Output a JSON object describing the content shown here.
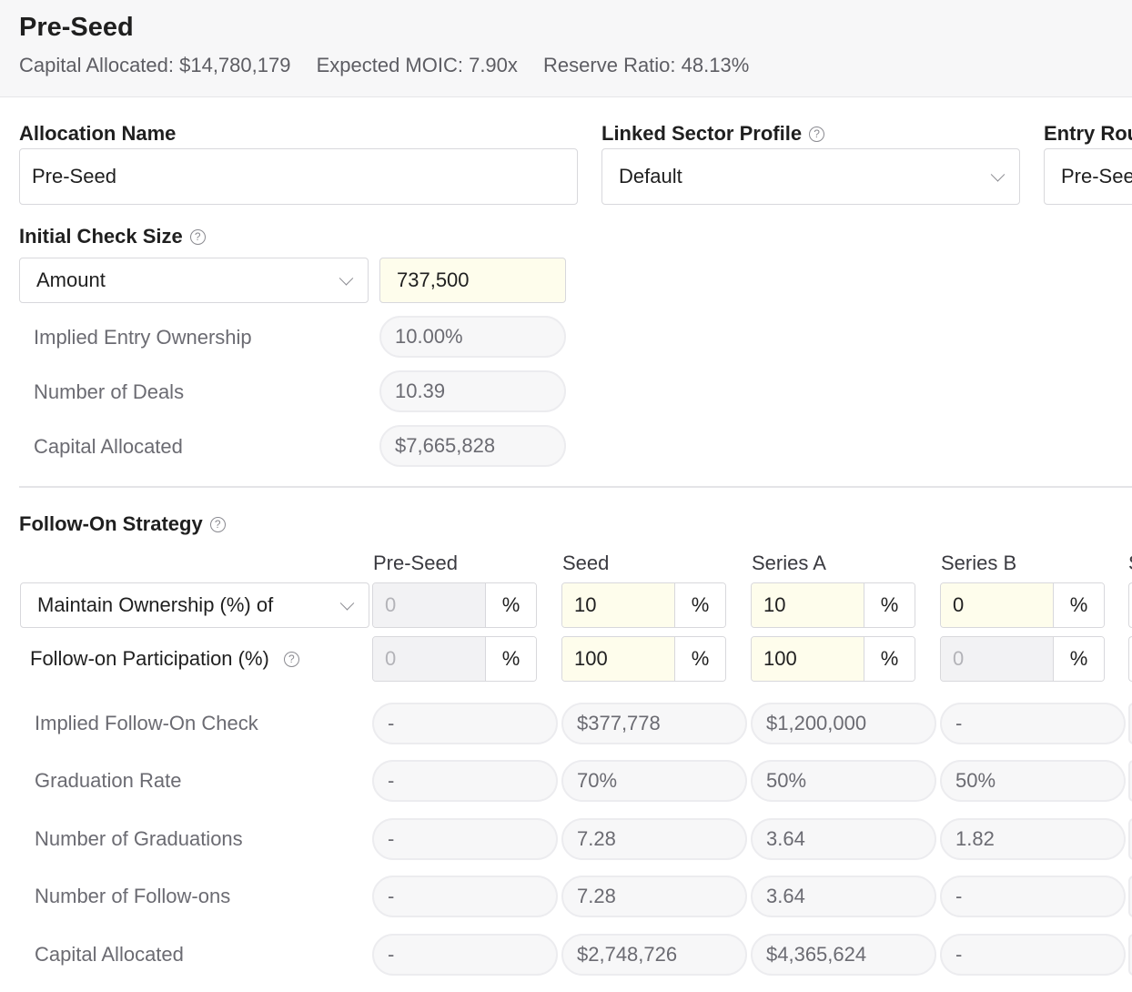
{
  "header": {
    "title": "Pre-Seed",
    "capital_allocated": "Capital Allocated: $14,780,179",
    "expected_moic": "Expected MOIC: 7.90x",
    "reserve_ratio": "Reserve Ratio: 48.13%"
  },
  "form": {
    "allocation_name_label": "Allocation Name",
    "allocation_name_value": "Pre-Seed",
    "linked_sector_label": "Linked Sector Profile",
    "linked_sector_value": "Default",
    "entry_round_label": "Entry Rou",
    "entry_round_value": "Pre-See",
    "help_glyph": "?"
  },
  "initial_check": {
    "label": "Initial Check Size",
    "mode_value": "Amount",
    "amount_value": "737,500",
    "rows": [
      {
        "label": "Implied Entry Ownership",
        "value": "10.00%"
      },
      {
        "label": "Number of Deals",
        "value": "10.39"
      },
      {
        "label": "Capital Allocated",
        "value": "$7,665,828"
      }
    ]
  },
  "follow_on": {
    "label": "Follow-On Strategy",
    "strategy_value": "Maintain Ownership (%) of",
    "participation_label": "Follow-on Participation (%)",
    "unit": "%",
    "columns": [
      "Pre-Seed",
      "Seed",
      "Series A",
      "Series B",
      "S"
    ],
    "maintain_values": [
      "0",
      "10",
      "10",
      "0"
    ],
    "participation_values": [
      "0",
      "100",
      "100",
      "0"
    ],
    "rows": [
      {
        "label": "Implied Follow-On Check",
        "values": [
          "-",
          "$377,778",
          "$1,200,000",
          "-"
        ]
      },
      {
        "label": "Graduation Rate",
        "values": [
          "-",
          "70%",
          "50%",
          "50%"
        ]
      },
      {
        "label": "Number of Graduations",
        "values": [
          "-",
          "7.28",
          "3.64",
          "1.82"
        ]
      },
      {
        "label": "Number of Follow-ons",
        "values": [
          "-",
          "7.28",
          "3.64",
          "-"
        ]
      },
      {
        "label": "Capital Allocated",
        "values": [
          "-",
          "$2,748,726",
          "$4,365,624",
          "-"
        ]
      }
    ]
  },
  "colors": {
    "highlight_input": "#fefdec",
    "disabled_input": "#f2f2f4",
    "header_bg": "#f7f7f8"
  }
}
